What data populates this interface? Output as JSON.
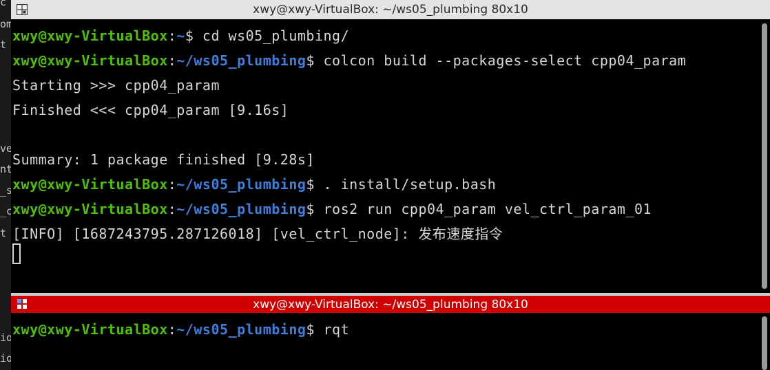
{
  "left_strip_fragments": [
    "c",
    "om",
    "t",
    "ve",
    "nt",
    "_s",
    "_c",
    "t",
    "ior",
    "ior"
  ],
  "top_terminal": {
    "title": "xwy@xwy-VirtualBox: ~/ws05_plumbing 80x10",
    "lines": [
      {
        "user": "xwy@xwy-VirtualBox",
        "colon": ":",
        "path": "~",
        "dollar": "$",
        "cmd": " cd ws05_plumbing/"
      },
      {
        "user": "xwy@xwy-VirtualBox",
        "colon": ":",
        "path": "~/ws05_plumbing",
        "dollar": "$",
        "cmd": " colcon build --packages-select cpp04_param"
      },
      {
        "text": "Starting >>> cpp04_param"
      },
      {
        "text": "Finished <<< cpp04_param [9.16s]"
      },
      {
        "text": ""
      },
      {
        "text": "Summary: 1 package finished [9.28s]"
      },
      {
        "user": "xwy@xwy-VirtualBox",
        "colon": ":",
        "path": "~/ws05_plumbing",
        "dollar": "$",
        "cmd": " . install/setup.bash"
      },
      {
        "user": "xwy@xwy-VirtualBox",
        "colon": ":",
        "path": "~/ws05_plumbing",
        "dollar": "$",
        "cmd": " ros2 run cpp04_param vel_ctrl_param_01"
      },
      {
        "text": "[INFO] [1687243795.287126018] [vel_ctrl_node]: 发布速度指令"
      }
    ]
  },
  "bottom_terminal": {
    "title": "xwy@xwy-VirtualBox: ~/ws05_plumbing 80x10",
    "lines": [
      {
        "user": "xwy@xwy-VirtualBox",
        "colon": ":",
        "path": "~/ws05_plumbing",
        "dollar": "$",
        "cmd": " rqt"
      }
    ]
  },
  "colors": {
    "prompt_user": "#4ec200",
    "prompt_path": "#3d7fd9",
    "text": "#d6d6d6",
    "active_titlebar": "#d10000",
    "inactive_titlebar": "#e4e4e4"
  }
}
